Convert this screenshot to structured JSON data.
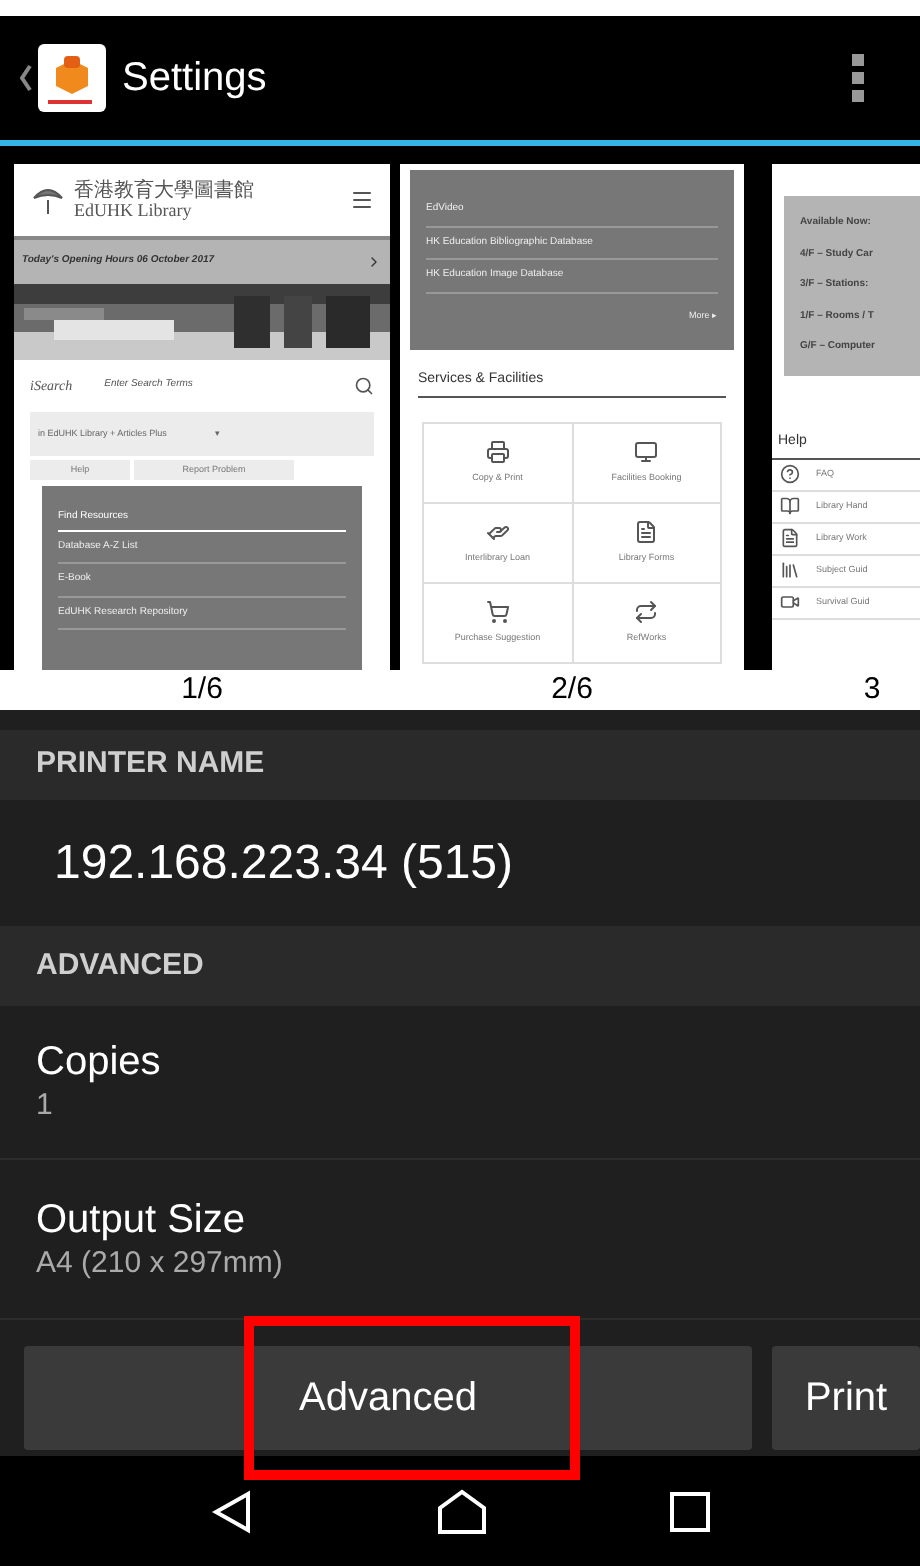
{
  "action_bar": {
    "title": "Settings"
  },
  "preview": {
    "pages": [
      {
        "kind": "home",
        "logo_cn": "香港教育大學圖書館",
        "logo_en": "EdUHK Library",
        "banner": "Today's Opening Hours  06 October 2017",
        "search_label": "iSearch",
        "search_placeholder": "Enter Search Terms",
        "scope": "in EdUHK Library + Articles Plus",
        "scope_caret": "▾",
        "links": [
          "Help",
          "Report Problem"
        ],
        "panel_title": "Find Resources",
        "panel_items": [
          "Database A-Z List",
          "E-Book",
          "EdUHK Research Repository"
        ]
      },
      {
        "kind": "services",
        "panel_items": [
          "EdVideo",
          "HK Education Bibliographic Database",
          "HK Education Image Database"
        ],
        "more": "More",
        "more_arrow": "▸",
        "heading": "Services & Facilities",
        "tiles": [
          {
            "kind": "print",
            "label": "Copy & Print"
          },
          {
            "kind": "monitor",
            "label": "Facilities Booking"
          },
          {
            "kind": "hand",
            "label": "Interlibrary Loan"
          },
          {
            "kind": "form",
            "label": "Library Forms"
          },
          {
            "kind": "cart",
            "label": "Purchase Suggestion"
          },
          {
            "kind": "ref",
            "label": "RefWorks"
          }
        ]
      },
      {
        "kind": "help",
        "box_lines": [
          "Available Now:",
          "4/F – Study Car",
          "3/F – Stations:",
          "1/F – Rooms / T",
          "G/F – Computer"
        ],
        "heading": "Help",
        "items": [
          {
            "kind": "faq",
            "label": "FAQ"
          },
          {
            "kind": "book",
            "label": "Library Hand"
          },
          {
            "kind": "doc",
            "label": "Library Work"
          },
          {
            "kind": "guide",
            "label": "Subject Guid"
          },
          {
            "kind": "video",
            "label": "Survival Guid"
          }
        ]
      }
    ],
    "labels": [
      "1/6",
      "2/6",
      "3"
    ]
  },
  "printer": {
    "header": "PRINTER NAME",
    "name": "192.168.223.34 (515)"
  },
  "advanced": {
    "header": "ADVANCED",
    "settings": [
      {
        "label": "Copies",
        "value": "1"
      },
      {
        "label": "Output Size",
        "value": "A4 (210 x 297mm)"
      }
    ]
  },
  "buttons": [
    {
      "label": "Advanced",
      "highlighted": true
    },
    {
      "label": "Print",
      "highlighted": false
    }
  ]
}
